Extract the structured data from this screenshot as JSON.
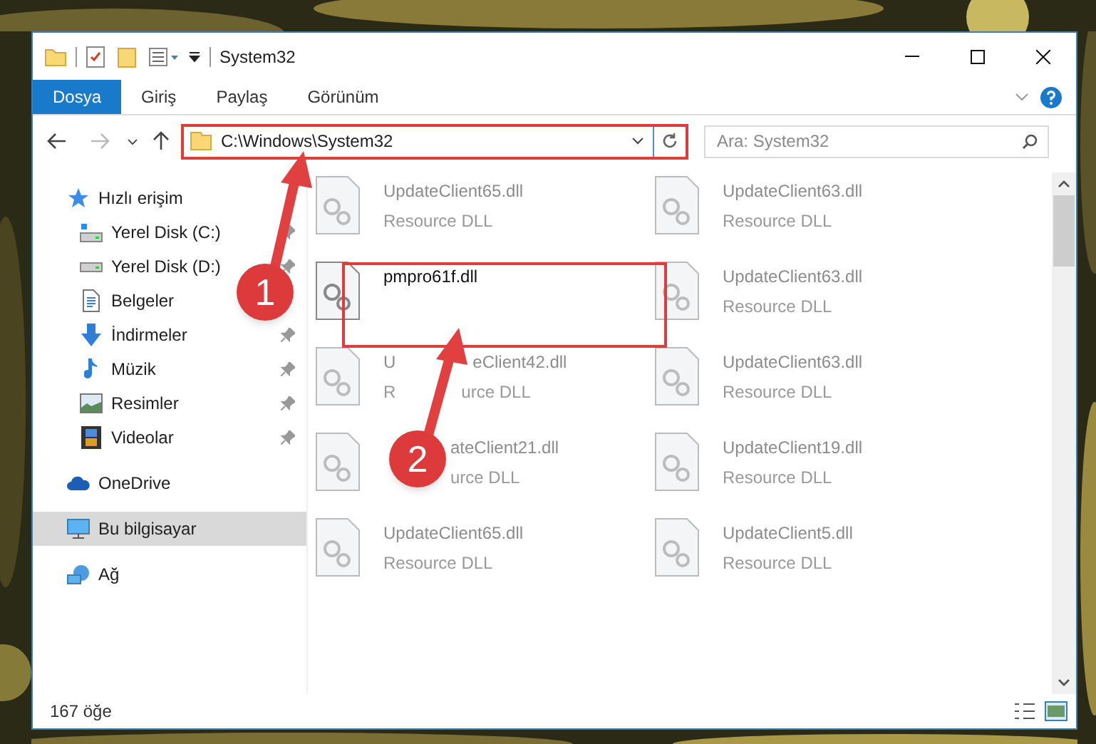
{
  "window": {
    "title": "System32"
  },
  "ribbon_tabs": [
    {
      "label": "Dosya",
      "selected": true
    },
    {
      "label": "Giriş",
      "selected": false
    },
    {
      "label": "Paylaş",
      "selected": false
    },
    {
      "label": "Görünüm",
      "selected": false
    }
  ],
  "address_bar": {
    "path": "C:\\Windows\\System32"
  },
  "search": {
    "placeholder": "Ara: System32"
  },
  "navigation": [
    {
      "label": "Hızlı erişim",
      "selected": false,
      "children": [
        {
          "label": "Yerel Disk (C:)",
          "pinned": true
        },
        {
          "label": "Yerel Disk (D:)",
          "pinned": true
        },
        {
          "label": "Belgeler"
        },
        {
          "label": "İndirmeler",
          "pinned": true
        },
        {
          "label": "Müzik",
          "pinned": true
        },
        {
          "label": "Resimler",
          "pinned": true
        },
        {
          "label": "Videolar",
          "pinned": true
        }
      ]
    },
    {
      "label": "OneDrive",
      "selected": false
    },
    {
      "label": "Bu bilgisayar",
      "selected": true
    },
    {
      "label": "Ağ",
      "selected": false
    }
  ],
  "files": [
    {
      "name": "UpdateClient65.dll",
      "type": "Resource DLL",
      "dimmed": true
    },
    {
      "name": "UpdateClient63.dll",
      "type": "Resource DLL",
      "dimmed": true
    },
    {
      "name": "pmpro61f.dll",
      "dimmed": false
    },
    {
      "name": "UpdateClient63.dll",
      "type": "Resource DLL",
      "dimmed": true
    },
    {
      "name_parts": [
        "U",
        "eClient42.dll"
      ],
      "type_parts": [
        "R",
        "urce DLL"
      ],
      "dimmed": true
    },
    {
      "name": "UpdateClient63.dll",
      "type": "Resource DLL",
      "dimmed": true
    },
    {
      "name": "ateClient21.dll",
      "type": "urce DLL",
      "covered_start": true,
      "dimmed": true
    },
    {
      "name": "UpdateClient19.dll",
      "type": "Resource DLL",
      "dimmed": true
    },
    {
      "name": "UpdateClient65.dll",
      "type": "Resource DLL",
      "dimmed": true
    },
    {
      "name": "UpdateClient5.dll",
      "type": "Resource DLL",
      "dimmed": true
    }
  ],
  "status_bar": {
    "item_count": "167 öğe"
  },
  "annotations": [
    {
      "label": "1"
    },
    {
      "label": "2"
    }
  ]
}
